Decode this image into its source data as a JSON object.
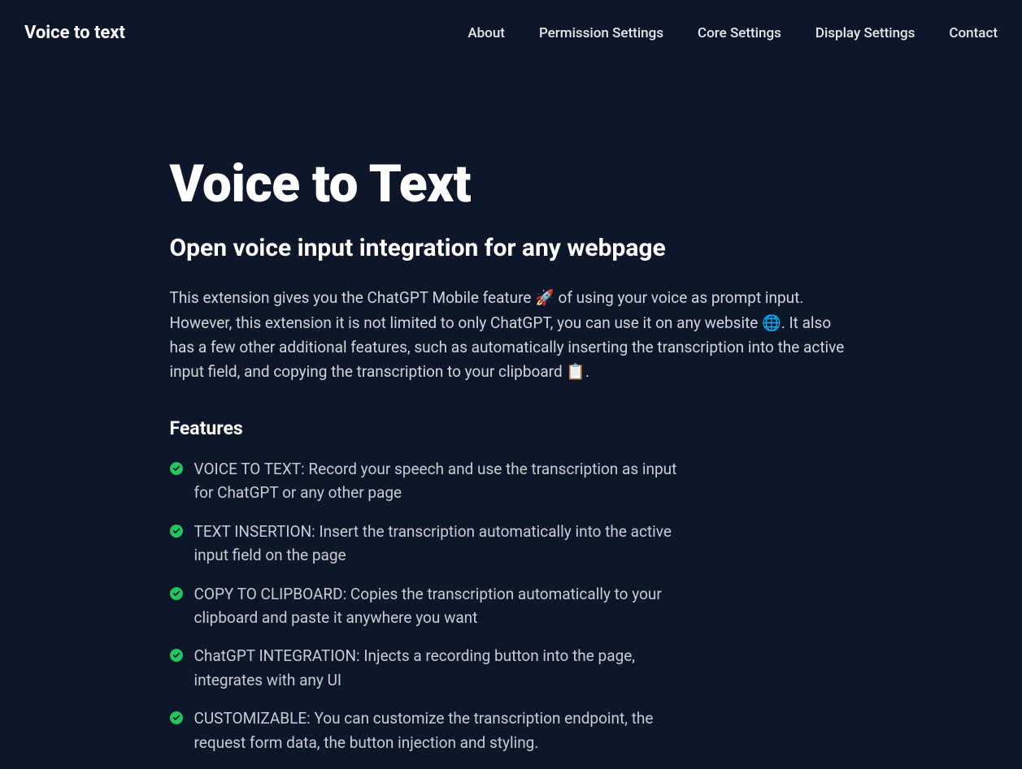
{
  "header": {
    "logo": "Voice to text",
    "nav": [
      "About",
      "Permission Settings",
      "Core Settings",
      "Display Settings",
      "Contact"
    ]
  },
  "hero": {
    "title": "Voice to Text",
    "subtitle": "Open voice input integration for any webpage",
    "intro": "This extension gives you the ChatGPT Mobile feature 🚀 of using your voice as prompt input. However, this extension it is not limited to only ChatGPT, you can use it on any website 🌐. It also has a few other additional features, such as automatically inserting the transcription into the active input field, and copying the transcription to your clipboard 📋."
  },
  "features": {
    "heading": "Features",
    "items": [
      "VOICE TO TEXT: Record your speech and use the transcription as input for ChatGPT or any other page",
      "TEXT INSERTION: Insert the transcription automatically into the active input field on the page",
      "COPY TO CLIPBOARD: Copies the transcription automatically to your clipboard and paste it anywhere you want",
      "ChatGPT INTEGRATION: Injects a recording button into the page, integrates with any UI",
      "CUSTOMIZABLE: You can customize the transcription endpoint, the request form data, the button injection and styling."
    ]
  }
}
